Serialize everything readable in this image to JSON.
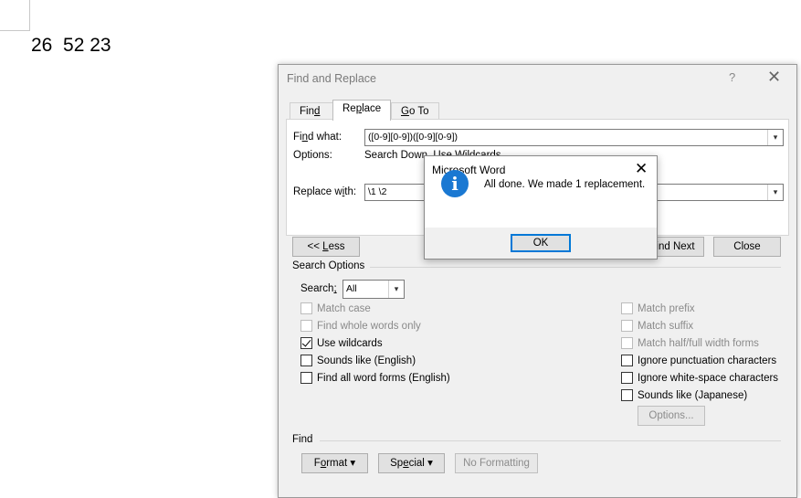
{
  "document": {
    "text": "26  52 23"
  },
  "find_replace": {
    "title": "Find and Replace",
    "help_label": "?",
    "close_label": "✕",
    "tabs": [
      {
        "label_pre": "Fin",
        "label_ul": "d",
        "label_post": ""
      },
      {
        "label_pre": "Re",
        "label_ul": "p",
        "label_post": "lace"
      },
      {
        "label_pre": "",
        "label_ul": "G",
        "label_post": "o To"
      }
    ],
    "find_what_label_pre": "Fi",
    "find_what_label_ul": "n",
    "find_what_label_post": "d what:",
    "find_what_value": "([0-9][0-9])([0-9][0-9])",
    "options_label": "Options:",
    "options_value": "Search Down, Use Wildcards",
    "replace_with_label_pre": "Replace w",
    "replace_with_label_ul": "i",
    "replace_with_label_post": "th:",
    "replace_with_value": "\\1 \\2",
    "less_button_pre": "<< ",
    "less_button_ul": "L",
    "less_button_post": "ess",
    "find_next_button": "Find Next",
    "close_button": "Close",
    "search_options_title": "Search Options",
    "search_label_pre": "Search",
    "search_label_ul": ";",
    "search_value": "All",
    "left_options": [
      {
        "label": "Match case",
        "checked": false,
        "disabled": true
      },
      {
        "label": "Find whole words only",
        "checked": false,
        "disabled": true
      },
      {
        "label": "Use wildcards",
        "checked": true,
        "disabled": false
      },
      {
        "label": "Sounds like (English)",
        "checked": false,
        "disabled": false
      },
      {
        "label": "Find all word forms (English)",
        "checked": false,
        "disabled": false
      }
    ],
    "right_options": [
      {
        "label": "Match prefix",
        "checked": false,
        "disabled": true
      },
      {
        "label": "Match suffix",
        "checked": false,
        "disabled": true
      },
      {
        "label": "Match half/full width forms",
        "checked": false,
        "disabled": true
      },
      {
        "label": "Ignore punctuation characters",
        "checked": false,
        "disabled": false
      },
      {
        "label": "Ignore white-space characters",
        "checked": false,
        "disabled": false
      },
      {
        "label": "Sounds like (Japanese)",
        "checked": false,
        "disabled": false
      }
    ],
    "options_button": "Options...",
    "find_section_title": "Find",
    "format_button_pre": "F",
    "format_button_ul": "o",
    "format_button_post": "rmat",
    "special_button_pre": "Sp",
    "special_button_ul": "e",
    "special_button_post": "cial",
    "dropdown_arrow": "▾",
    "no_formatting_button": "No Formatting"
  },
  "message_box": {
    "title": "Microsoft Word",
    "close_label": "✕",
    "icon": "info-icon",
    "icon_glyph": "i",
    "message": "All done. We made 1 replacement.",
    "ok_button": "OK"
  }
}
